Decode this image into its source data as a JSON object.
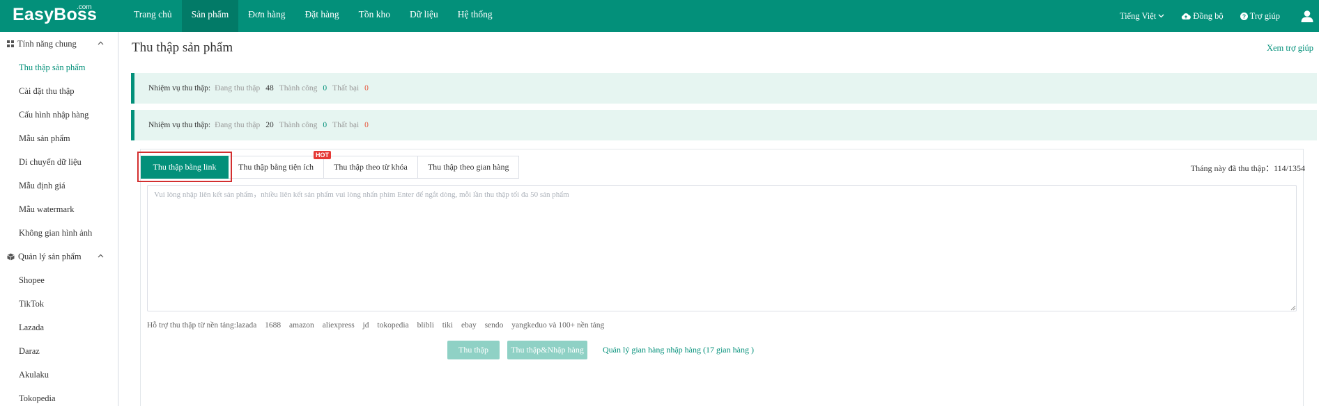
{
  "header": {
    "logo": "EasyBoss",
    "logo_suffix": ".com",
    "nav": [
      "Trang chủ",
      "Sản phẩm",
      "Đơn hàng",
      "Đặt hàng",
      "Tồn kho",
      "Dữ liệu",
      "Hệ thống"
    ],
    "active_nav": "Sản phẩm",
    "language": "Tiếng Việt",
    "sync": "Đồng bộ",
    "help": "Trợ giúp"
  },
  "sidebar": {
    "group1": {
      "label": "Tính năng chung",
      "icon": "grid-icon"
    },
    "group1_items": [
      "Thu thập sản phẩm",
      "Cài đặt thu thập",
      "Cấu hình nhập hàng",
      "Mẫu sản phẩm",
      "Di chuyển dữ liệu",
      "Mẫu định giá",
      "Mẫu watermark",
      "Không gian hình ảnh"
    ],
    "active_item": "Thu thập sản phẩm",
    "group2": {
      "label": "Quản lý sản phẩm",
      "icon": "box-icon"
    },
    "group2_items": [
      "Shopee",
      "TikTok",
      "Lazada",
      "Daraz",
      "Akulaku",
      "Tokopedia"
    ]
  },
  "page": {
    "title": "Thu thập sản phẩm",
    "help_link": "Xem trợ giúp"
  },
  "tasks": [
    {
      "label": "Nhiệm vụ thu thập:",
      "collecting_label": "Đang thu thập",
      "collecting": "48",
      "success_label": "Thành công",
      "success": "0",
      "failed_label": "Thất bại",
      "failed": "0"
    },
    {
      "label": "Nhiệm vụ thu thập:",
      "collecting_label": "Đang thu thập",
      "collecting": "20",
      "success_label": "Thành công",
      "success": "0",
      "failed_label": "Thất bại",
      "failed": "0"
    }
  ],
  "tabs": [
    "Thu thập bằng link",
    "Thu thập bằng tiện ích",
    "Thu thập theo từ khóa",
    "Thu thập theo gian hàng"
  ],
  "active_tab": "Thu thập bằng link",
  "hot_badge": "HOT",
  "month_count": "Tháng này đã thu thập：114/1354",
  "input": {
    "value": "",
    "placeholder": "Vui lòng nhập liên kết sản phẩm，nhiều liên kết sản phẩm vui lòng nhấn phím Enter để ngắt dòng, mỗi lần thu thập tối đa 50 sản phẩm"
  },
  "platforms": {
    "prefix": "Hỗ trợ thu thập từ nền tảng:lazada",
    "list": [
      "1688",
      "amazon",
      "aliexpress",
      "jd",
      "tokopedia",
      "blibli",
      "tiki",
      "ebay",
      "sendo",
      "yangkeduo và 100+ nền tảng"
    ]
  },
  "actions": {
    "collect": "Thu thập",
    "collect_import": "Thu thập&Nhập hàng",
    "manage_link": "Quản lý gian hàng nhập hàng (17 gian hàng )"
  },
  "colors": {
    "primary": "#03907a",
    "primary_dark": "#027a67",
    "disabled_button": "#8fd1c5",
    "failed": "#e6553a",
    "highlight_box": "#d32f2f"
  }
}
